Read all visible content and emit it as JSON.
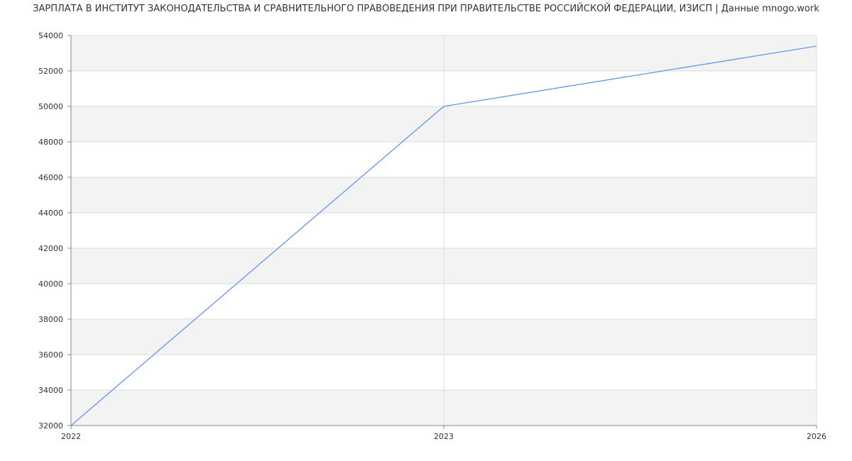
{
  "chart_data": {
    "type": "line",
    "title": "ЗАРПЛАТА В ИНСТИТУТ ЗАКОНОДАТЕЛЬСТВА И СРАВНИТЕЛЬНОГО ПРАВОВЕДЕНИЯ ПРИ ПРАВИТЕЛЬСТВЕ РОССИЙСКОЙ ФЕДЕРАЦИИ, ИЗИСП | Данные mnogo.work",
    "xlabel": "",
    "ylabel": "",
    "categories": [
      "2022",
      "2023",
      "2026"
    ],
    "series": [
      {
        "values": [
          32000,
          50000,
          53400
        ],
        "color": "#6495ED"
      }
    ],
    "ylim": [
      32000,
      54000
    ],
    "yticks": [
      32000,
      34000,
      36000,
      38000,
      40000,
      42000,
      44000,
      46000,
      48000,
      50000,
      52000,
      54000
    ],
    "grid": true,
    "band_colors": [
      "#ffffff",
      "#f3f3f3"
    ],
    "axis_color": "#888888",
    "grid_color": "#dddddd"
  }
}
